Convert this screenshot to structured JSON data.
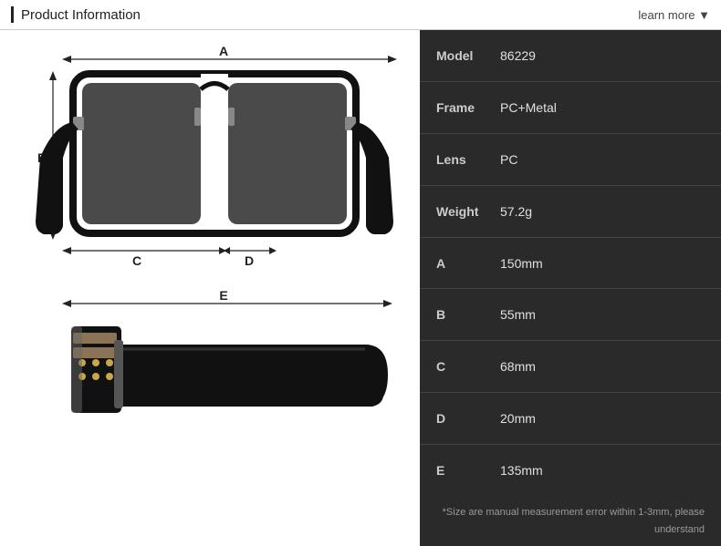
{
  "header": {
    "title": "Product Information",
    "learn_more_label": "learn more ▼"
  },
  "specs": {
    "rows": [
      {
        "label": "Model",
        "value": "86229"
      },
      {
        "label": "Frame",
        "value": "PC+Metal"
      },
      {
        "label": "Lens",
        "value": "PC"
      },
      {
        "label": "Weight",
        "value": "57.2g"
      },
      {
        "label": "A",
        "value": "150mm"
      },
      {
        "label": "B",
        "value": "55mm"
      },
      {
        "label": "C",
        "value": "68mm"
      },
      {
        "label": "D",
        "value": "20mm"
      },
      {
        "label": "E",
        "value": "135mm"
      }
    ]
  },
  "note": "*Size are manual measurement error within 1-3mm,\nplease understand",
  "diagram": {
    "labels": {
      "a": "A",
      "b": "B",
      "c": "C",
      "d": "D",
      "e": "E"
    }
  }
}
